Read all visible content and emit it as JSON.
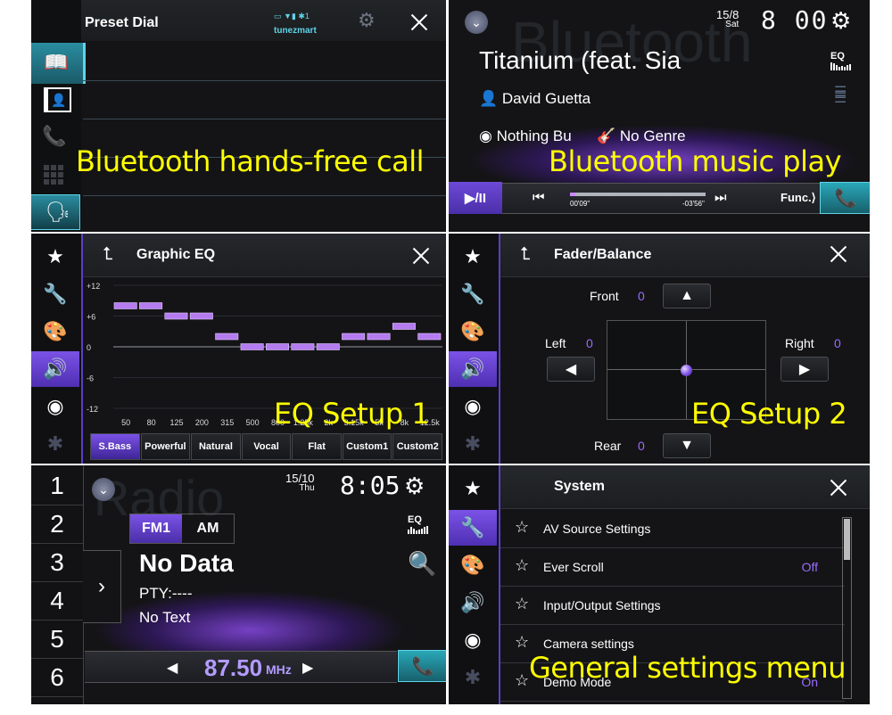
{
  "captions": {
    "p1": "Bluetooth hands-free call",
    "p2": "Bluetooth music play",
    "p3": "EQ Setup 1",
    "p4": "EQ Setup 2",
    "p6": "General settings menu"
  },
  "phone": {
    "title": "Preset Dial",
    "device_name": "tunezmart",
    "status_icons": [
      "battery-icon",
      "signal-icon",
      "bluetooth-icon"
    ],
    "status_count": "1",
    "sidebar": [
      "phonebook-icon",
      "contacts-icon",
      "call-history-icon",
      "keypad-icon",
      "voice-recognition-icon"
    ],
    "active_sidebar_index": 0,
    "preset_rows": 5
  },
  "music": {
    "date": "15/8",
    "day": "Sat",
    "time": "8 00",
    "watermark": "Bluetooth",
    "track": "Titanium (feat. Sia",
    "artist": "David Guetta",
    "album": "Nothing Bu",
    "genre": "No Genre",
    "eq_label": "EQ",
    "elapsed": "00'09\"",
    "remaining": "-03'56\"",
    "progress": 0.04,
    "func_label": "Func.",
    "play_pause": "▶/II"
  },
  "eq": {
    "title": "Graphic EQ",
    "presets": [
      "S.Bass",
      "Powerful",
      "Natural",
      "Vocal",
      "Flat",
      "Custom1",
      "Custom2"
    ],
    "active_preset": "S.Bass",
    "sidebar": [
      "star-icon",
      "settings-tools-icon",
      "theme-palette-icon",
      "audio-icon",
      "disc-icon",
      "bluetooth-icon"
    ],
    "active_sidebar_index": 3
  },
  "chart_data": {
    "type": "bar",
    "title": "Graphic EQ",
    "categories": [
      "50",
      "80",
      "125",
      "200",
      "315",
      "500",
      "800",
      "1.25k",
      "2k",
      "3.15k",
      "5k",
      "8k",
      "12.5k"
    ],
    "values": [
      8,
      8,
      6,
      6,
      2,
      0,
      0,
      0,
      0,
      2,
      2,
      4,
      2
    ],
    "yticks": [
      "+12",
      "+6",
      "0",
      "-6",
      "-12"
    ],
    "ylim": [
      -12,
      12
    ],
    "xlabel": "",
    "ylabel": "",
    "grid": true
  },
  "fader": {
    "title": "Fader/Balance",
    "front_label": "Front",
    "front_value": "0",
    "rear_label": "Rear",
    "rear_value": "0",
    "left_label": "Left",
    "left_value": "0",
    "right_label": "Right",
    "right_value": "0",
    "balance": 0,
    "fader": 0
  },
  "radio": {
    "presets": [
      "1",
      "2",
      "3",
      "4",
      "5",
      "6"
    ],
    "date": "15/10",
    "day": "Thu",
    "time": "8:05",
    "watermark": "Radio",
    "bands": [
      "FM1",
      "AM"
    ],
    "active_band": "FM1",
    "station": "No Data",
    "pty": "PTY:----",
    "text": "No Text",
    "frequency": "87.50",
    "unit": "MHz",
    "eq_label": "EQ"
  },
  "system": {
    "title": "System",
    "items": [
      {
        "label": "AV Source Settings",
        "value": ""
      },
      {
        "label": "Ever Scroll",
        "value": "Off"
      },
      {
        "label": "Input/Output Settings",
        "value": ""
      },
      {
        "label": "Camera settings",
        "value": ""
      },
      {
        "label": "Demo Mode",
        "value": "On"
      }
    ],
    "active_sidebar_index": 1
  },
  "colors": {
    "accent_purple": "#7b52e6",
    "accent_teal": "#2aa7b8",
    "value_purple": "#9b6bff",
    "device_name": "#5fd3e6",
    "caption_yellow": "#ffff00"
  }
}
